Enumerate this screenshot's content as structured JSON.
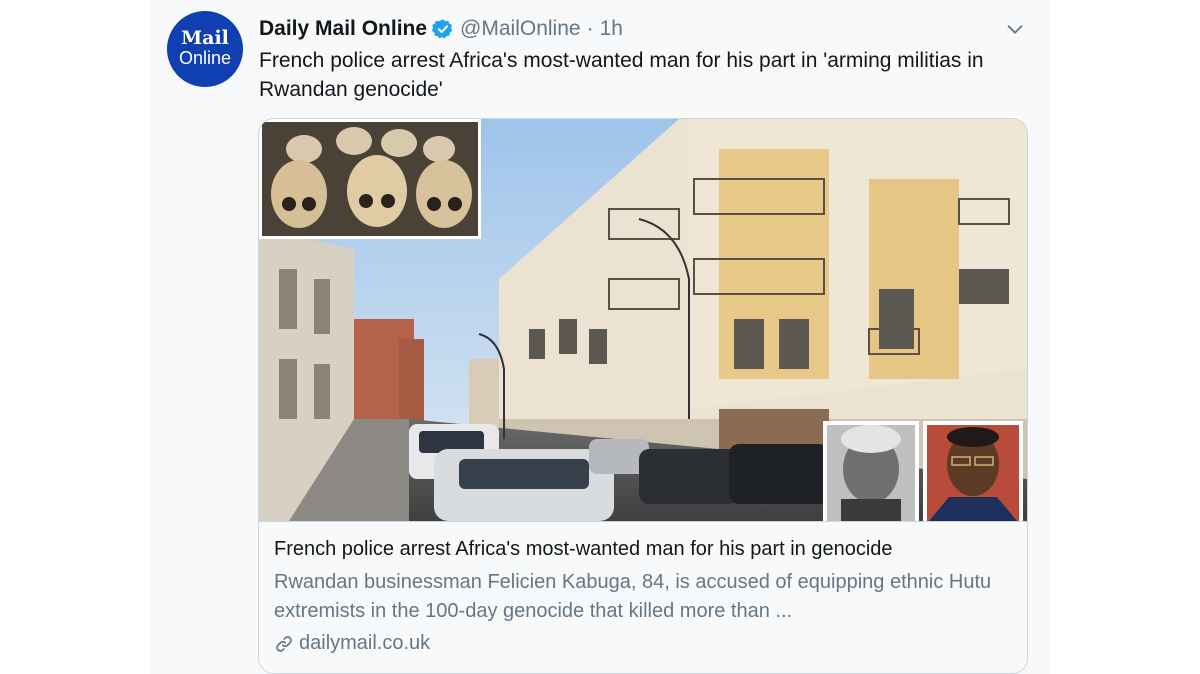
{
  "tweet": {
    "avatar_logo_top": "Mail",
    "avatar_logo_bottom": "Online",
    "author_name": "Daily Mail Online",
    "handle": "@MailOnline",
    "separator": "·",
    "time": "1h",
    "text": "French police arrest Africa's most-wanted man for his part in 'arming militias in Rwandan genocide'",
    "icons": {
      "verified": "verified-badge-icon",
      "menu": "chevron-down-icon",
      "link": "link-icon"
    }
  },
  "card": {
    "image_description": "Apartment building street with skull inset and two portrait photos",
    "title": "French police arrest Africa's most-wanted man for his part in genocide",
    "description": "Rwandan businessman Felicien Kabuga, 84, is accused of equipping ethnic Hutu extremists in the 100-day genocide that killed more than ...",
    "domain": "dailymail.co.uk"
  },
  "colors": {
    "brand": "#0f3fb0",
    "verified": "#1da1f2",
    "text_primary": "#14171a",
    "text_secondary": "#657786",
    "border": "#ccd6dd",
    "background": "#f7f9fa"
  }
}
